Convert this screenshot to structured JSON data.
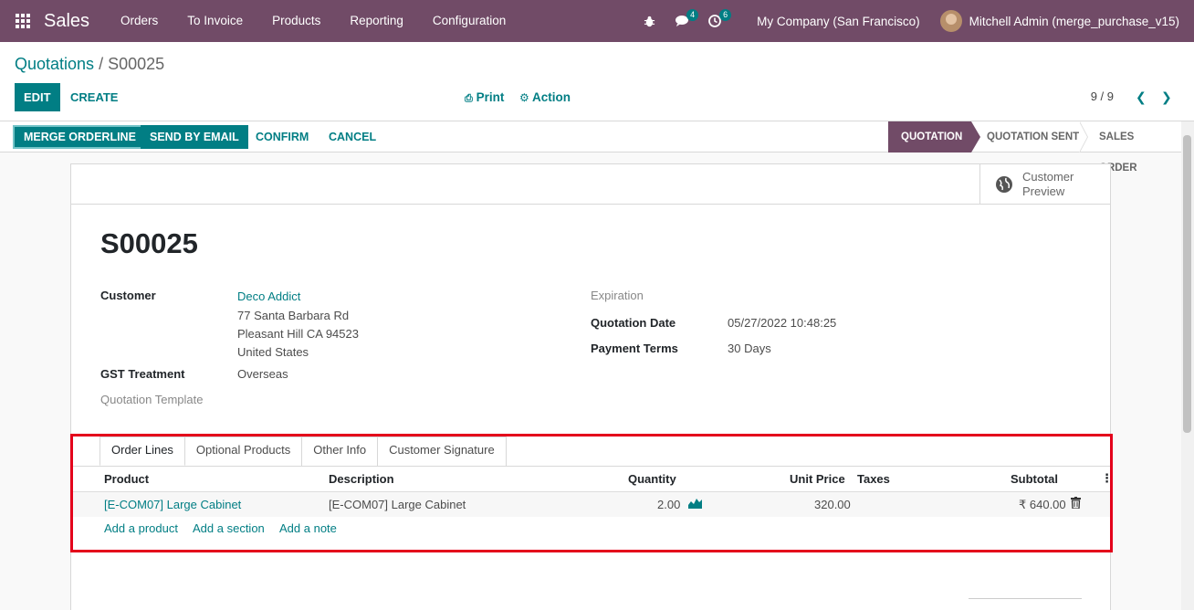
{
  "navbar": {
    "app_name": "Sales",
    "menu": [
      "Orders",
      "To Invoice",
      "Products",
      "Reporting",
      "Configuration"
    ],
    "messages_count": "4",
    "activities_count": "6",
    "company": "My Company (San Francisco)",
    "user": "Mitchell Admin (merge_purchase_v15)"
  },
  "breadcrumb": {
    "parent": "Quotations",
    "separator": "/",
    "current": "S00025"
  },
  "control": {
    "edit_label": "EDIT",
    "create_label": "CREATE",
    "print_label": "Print",
    "action_label": "Action",
    "pager": "9 / 9"
  },
  "statusbar": {
    "merge_label": "MERGE ORDERLINE",
    "email_label": "SEND BY EMAIL",
    "confirm_label": "CONFIRM",
    "cancel_label": "CANCEL",
    "stages": [
      "QUOTATION",
      "QUOTATION SENT",
      "SALES ORDER"
    ],
    "active_stage": "QUOTATION"
  },
  "sheet": {
    "preview_label_1": "Customer",
    "preview_label_2": "Preview",
    "title": "S00025",
    "customer_label": "Customer",
    "customer_name": "Deco Addict",
    "address_1": "77 Santa Barbara Rd",
    "address_2": "Pleasant Hill CA 94523",
    "address_3": "United States",
    "gst_label": "GST Treatment",
    "gst_value": "Overseas",
    "template_label": "Quotation Template",
    "expiration_label": "Expiration",
    "quotation_date_label": "Quotation Date",
    "quotation_date_value": "05/27/2022 10:48:25",
    "payment_terms_label": "Payment Terms",
    "payment_terms_value": "30 Days"
  },
  "notebook": {
    "tabs": [
      "Order Lines",
      "Optional Products",
      "Other Info",
      "Customer Signature"
    ],
    "active_tab": "Order Lines",
    "columns": [
      "Product",
      "Description",
      "Quantity",
      "Unit Price",
      "Taxes",
      "Subtotal"
    ],
    "rows": [
      {
        "product": "[E-COM07] Large Cabinet",
        "description": "[E-COM07] Large Cabinet",
        "quantity": "2.00",
        "unit_price": "320.00",
        "taxes": "",
        "subtotal": "₹ 640.00"
      }
    ],
    "add_product": "Add a product",
    "add_section": "Add a section",
    "add_note": "Add a note"
  },
  "colors": {
    "brand": "#714b67",
    "accent": "#017e84",
    "highlight": "#e4001b"
  }
}
